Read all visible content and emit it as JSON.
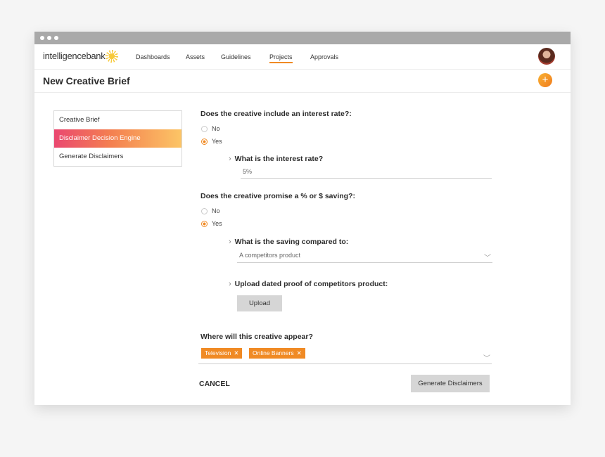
{
  "app": {
    "logo_text": "intelligencebank",
    "colors": {
      "accent": "#f08a24",
      "gradient_start": "#ea4870",
      "gradient_end": "#fcc566"
    }
  },
  "nav": {
    "items": [
      {
        "label": "Dashboards"
      },
      {
        "label": "Assets"
      },
      {
        "label": "Guidelines"
      },
      {
        "label": "Projects",
        "active": true
      },
      {
        "label": "Approvals"
      }
    ]
  },
  "header": {
    "title": "New Creative Brief",
    "add_icon": "+"
  },
  "sidebar": {
    "items": [
      {
        "label": "Creative Brief"
      },
      {
        "label": "Disclaimer Decision Engine",
        "active": true
      },
      {
        "label": "Generate Disclaimers"
      }
    ]
  },
  "form": {
    "q1": {
      "question": "Does the creative include an interest rate?:",
      "options": [
        "No",
        "Yes"
      ],
      "selected": "Yes",
      "sub_question": "What is the interest rate?",
      "value": "5%"
    },
    "q2": {
      "question": "Does the creative promise a % or $ saving?:",
      "options": [
        "No",
        "Yes"
      ],
      "selected": "Yes",
      "sub_question": "What is the saving compared to:",
      "dropdown_value": "A competitors product",
      "upload_question": "Upload dated proof of competitors product:",
      "upload_label": "Upload"
    },
    "q3": {
      "question": "Where will this creative appear?",
      "tags": [
        "Television",
        "Online Banners"
      ],
      "tag_remove": "✕"
    },
    "cancel_label": "CANCEL",
    "submit_label": "Generate Disclaimers"
  },
  "icons": {
    "chevron_right": "›",
    "chevron_down": "﹀"
  }
}
